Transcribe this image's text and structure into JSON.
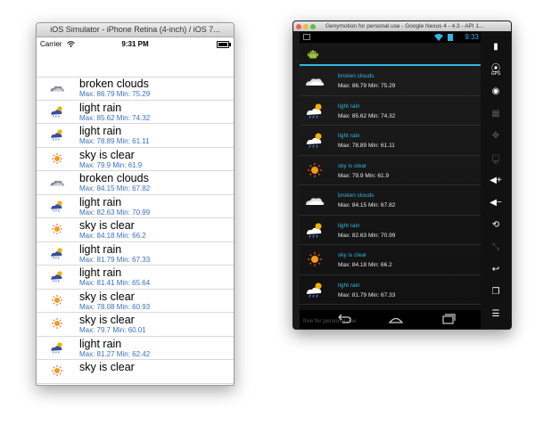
{
  "ios": {
    "window_title": "iOS Simulator - iPhone Retina (4-inch) / iOS 7...",
    "carrier": "Carrier",
    "time": "9:31 PM",
    "rows": [
      {
        "title": "broken clouds",
        "detail": "Max: 86.79 Min: 75.29",
        "icon": "broken-clouds-icon"
      },
      {
        "title": "light rain",
        "detail": "Max: 85.62 Min: 74.32",
        "icon": "light-rain-icon"
      },
      {
        "title": "light rain",
        "detail": "Max: 78.89 Min: 61.11",
        "icon": "light-rain-icon"
      },
      {
        "title": "sky is clear",
        "detail": "Max: 79.9 Min: 61.9",
        "icon": "sun-icon"
      },
      {
        "title": "broken clouds",
        "detail": "Max: 84.15 Min: 67.82",
        "icon": "broken-clouds-icon"
      },
      {
        "title": "light rain",
        "detail": "Max: 82.63 Min: 70.99",
        "icon": "light-rain-icon"
      },
      {
        "title": "sky is clear",
        "detail": "Max: 84.18 Min: 66.2",
        "icon": "sun-icon"
      },
      {
        "title": "light rain",
        "detail": "Max: 81.79 Min: 67.33",
        "icon": "light-rain-icon"
      },
      {
        "title": "light rain",
        "detail": "Max: 81.41 Min: 65.64",
        "icon": "light-rain-icon"
      },
      {
        "title": "sky is clear",
        "detail": "Max: 78.08 Min: 60.93",
        "icon": "sun-icon"
      },
      {
        "title": "sky is clear",
        "detail": "Max: 79.7 Min: 60.01",
        "icon": "sun-icon"
      },
      {
        "title": "light rain",
        "detail": "Max: 81.27 Min: 62.42",
        "icon": "light-rain-icon"
      },
      {
        "title": "sky is clear",
        "detail": "",
        "icon": "sun-icon"
      }
    ]
  },
  "android": {
    "window_title": "Genymotion for personal use - Google Nexus 4 - 4.3 - API 1...",
    "time": "9:33",
    "watermark": "free for personal use",
    "rows": [
      {
        "title": "broken clouds",
        "detail": "Max: 86.79 Min: 75.29",
        "icon": "broken-clouds-icon"
      },
      {
        "title": "light rain",
        "detail": "Max: 85.62 Min: 74.32",
        "icon": "light-rain-icon"
      },
      {
        "title": "light rain",
        "detail": "Max: 78.89 Min: 61.11",
        "icon": "light-rain-icon"
      },
      {
        "title": "sky is clear",
        "detail": "Max: 79.9 Min: 61.9",
        "icon": "sun-icon"
      },
      {
        "title": "broken clouds",
        "detail": "Max: 84.15 Min: 67.82",
        "icon": "broken-clouds-icon"
      },
      {
        "title": "light rain",
        "detail": "Max: 82.63 Min: 70.99",
        "icon": "light-rain-icon"
      },
      {
        "title": "sky is clear",
        "detail": "Max: 84.18 Min: 66.2",
        "icon": "sun-icon"
      },
      {
        "title": "light rain",
        "detail": "Max: 81.79 Min: 67.33",
        "icon": "light-rain-icon"
      }
    ],
    "side_buttons": [
      {
        "icon": "battery-icon"
      },
      {
        "icon": "gps-icon",
        "label": "GPS"
      },
      {
        "icon": "camera-icon"
      },
      {
        "icon": "screencast-icon"
      },
      {
        "icon": "dpad-icon"
      },
      {
        "icon": "id-icon",
        "label": "ID"
      },
      {
        "icon": "volume-up-icon"
      },
      {
        "icon": "volume-down-icon"
      },
      {
        "icon": "rotate-icon"
      },
      {
        "icon": "scale-icon"
      },
      {
        "icon": "back-icon"
      },
      {
        "icon": "recent-apps-icon"
      },
      {
        "icon": "menu-icon"
      }
    ]
  },
  "colors": {
    "android_accent": "#33b5e5",
    "ios_detail": "#3a6fc4"
  }
}
